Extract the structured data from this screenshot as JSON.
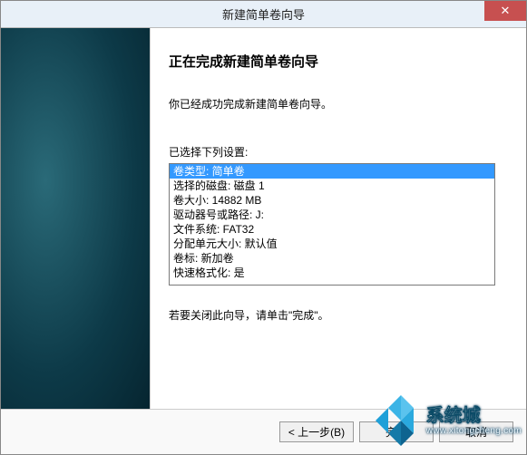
{
  "titlebar": {
    "title": "新建简单卷向导",
    "close": "✕"
  },
  "main": {
    "heading": "正在完成新建简单卷向导",
    "intro": "你已经成功完成新建简单卷向导。",
    "settings_label": "已选择下列设置:",
    "settings": [
      "卷类型: 简单卷",
      "选择的磁盘: 磁盘 1",
      "卷大小: 14882 MB",
      "驱动器号或路径: J:",
      "文件系统: FAT32",
      "分配单元大小: 默认值",
      "卷标: 新加卷",
      "快速格式化: 是"
    ],
    "closing": "若要关闭此向导，请单击\"完成\"。"
  },
  "buttons": {
    "back": "< 上一步(B)",
    "finish": "完成",
    "cancel": "取消"
  },
  "watermark": {
    "cn": "系统城",
    "en": "www.xitongcheng.com"
  }
}
